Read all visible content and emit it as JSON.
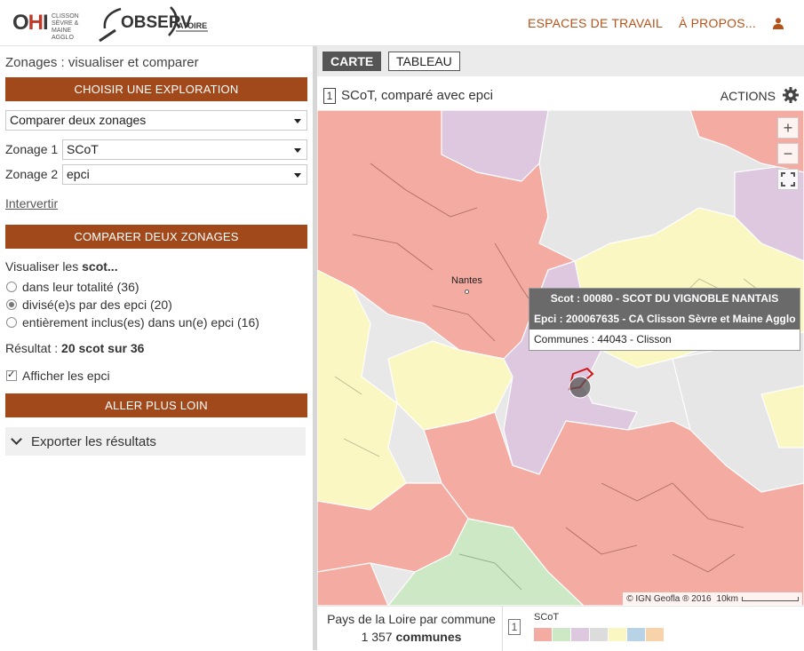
{
  "header": {
    "logo_ohi_text": "OHI",
    "logo_ohi_sub": "CLISSON SÈVRE & MAINE AGGLO",
    "logo_obs_text": "OBSERV",
    "logo_obs_suffix": "ATOIRE",
    "nav": [
      "ESPACES DE TRAVAIL",
      "À PROPOS..."
    ]
  },
  "left": {
    "title": "Zonages : visualiser et comparer",
    "explore_btn": "CHOISIR UNE EXPLORATION",
    "mode_select": "Comparer deux zonages",
    "zonage1_label": "Zonage 1",
    "zonage1_value": "SCoT",
    "zonage2_label": "Zonage 2",
    "zonage2_value": "epci",
    "swap_link": "Intervertir",
    "compare_btn": "COMPARER DEUX ZONAGES",
    "visualize_prefix": "Visualiser les ",
    "visualize_bold": "scot...",
    "radios": [
      {
        "label": "dans leur totalité (36)",
        "checked": false
      },
      {
        "label": "divisé(e)s par des epci (20)",
        "checked": true
      },
      {
        "label": "entièrement inclus(es) dans un(e) epci (16)",
        "checked": false
      }
    ],
    "result_prefix": "Résultat : ",
    "result_bold": "20 scot sur 36",
    "show_epci": "Afficher les epci",
    "go_further_btn": "ALLER PLUS LOIN",
    "export": "Exporter les résultats"
  },
  "right": {
    "tabs": [
      "CARTE",
      "TABLEAU"
    ],
    "map_number": "1",
    "map_title": "SCoT, comparé avec epci",
    "actions": "ACTIONS",
    "zoom_in": "+",
    "zoom_out": "−",
    "city": "Nantes",
    "tooltip": {
      "scot": "Scot : 00080 - SCOT DU VIGNOBLE NANTAIS",
      "epci": "Epci : 200067635 - CA Clisson Sèvre et Maine Agglo",
      "communes": "Communes : 44043 - Clisson"
    },
    "credits": "© IGN Geofla ® 2016",
    "scale_label": "10km",
    "footer_line1": "Pays de la Loire par commune",
    "footer_count": "1 357",
    "footer_unit": "communes",
    "legend_number": "1",
    "legend_title": "SCoT",
    "legend_colors": [
      "#f4aba2",
      "#cde8c4",
      "#ddc8e0",
      "#dcdcdc",
      "#faf7c2",
      "#b9d3e6",
      "#f8d3aa"
    ]
  },
  "colors": {
    "accent": "#a2491b",
    "nav_link": "#b5521a",
    "region_red": "#f4aba2",
    "region_yellow": "#faf7c2",
    "region_purple": "#ddc8e0",
    "region_green": "#cde8c4",
    "region_grey": "#e8e8e8"
  }
}
